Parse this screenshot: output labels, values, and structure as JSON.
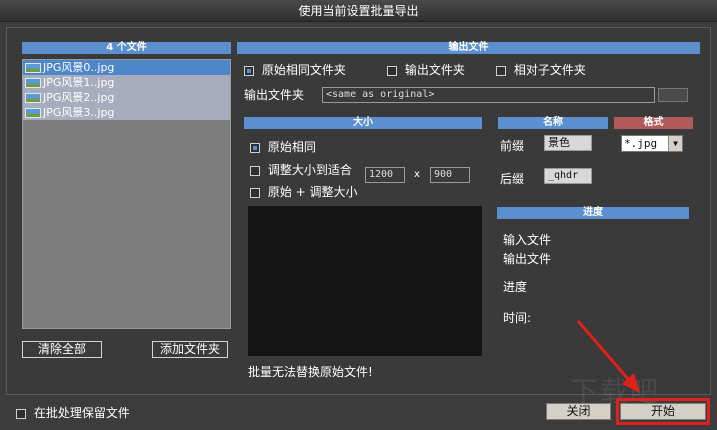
{
  "window": {
    "title": "使用当前设置批量导出"
  },
  "file_panel": {
    "header": "4 个文件",
    "files": [
      "JPG风景0..jpg",
      "JPG风景1..jpg",
      "JPG风景2..jpg",
      "JPG风景3..jpg"
    ],
    "selected_index": 0,
    "clear_all_label": "清除全部",
    "add_folder_label": "添加文件夹"
  },
  "output": {
    "header": "输出文件",
    "options": [
      {
        "label": "原始相同文件夹",
        "checked": true
      },
      {
        "label": "输出文件夹",
        "checked": false
      },
      {
        "label": "相对子文件夹",
        "checked": false
      }
    ],
    "folder_label": "输出文件夹",
    "folder_value": "<same as original>"
  },
  "size": {
    "header": "大小",
    "options": [
      {
        "label": "原始相同",
        "checked": true
      },
      {
        "label": "调整大小到适合",
        "checked": false
      },
      {
        "label": "原始 + 调整大小",
        "checked": false
      }
    ],
    "width": "1200",
    "x_label": "x",
    "height": "900"
  },
  "name": {
    "header": "名称",
    "prefix_label": "前缀",
    "prefix_value": "景色",
    "suffix_label": "后缀",
    "suffix_value": "_qhdr"
  },
  "format": {
    "header": "格式",
    "value": "*.jpg"
  },
  "progress": {
    "header": "进度",
    "input_file_label": "输入文件",
    "output_file_label": "输出文件",
    "progress_label": "进度",
    "time_label": "时间:"
  },
  "warning": "批量无法替换原始文件!",
  "footer": {
    "keep_files_label": "在批处理保留文件",
    "close_label": "关闭",
    "start_label": "开始"
  },
  "colors": {
    "accent_blue": "#5b8fd0",
    "format_header": "#b05a5a",
    "annotation_red": "#e0201a"
  },
  "watermark": "下载吧"
}
